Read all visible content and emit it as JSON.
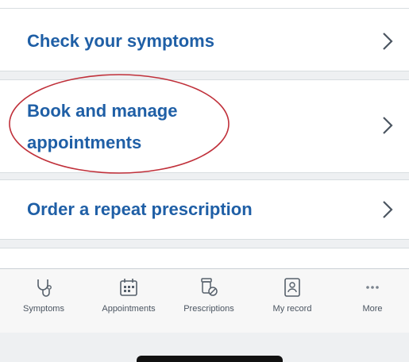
{
  "menu": {
    "items": [
      {
        "label": "Check your symptoms"
      },
      {
        "label_line1": "Book and manage",
        "label_line2": "appointments"
      },
      {
        "label": "Order a repeat prescription"
      }
    ]
  },
  "tabbar": {
    "tabs": [
      {
        "label": "Symptoms",
        "icon": "stethoscope-icon"
      },
      {
        "label": "Appointments",
        "icon": "calendar-icon"
      },
      {
        "label": "Prescriptions",
        "icon": "pills-icon"
      },
      {
        "label": "My record",
        "icon": "record-icon"
      },
      {
        "label": "More",
        "icon": "more-dots-icon"
      }
    ]
  },
  "colors": {
    "link": "#1f5fa6",
    "highlight_ellipse": "#c0303a",
    "background": "#eef0f2"
  }
}
